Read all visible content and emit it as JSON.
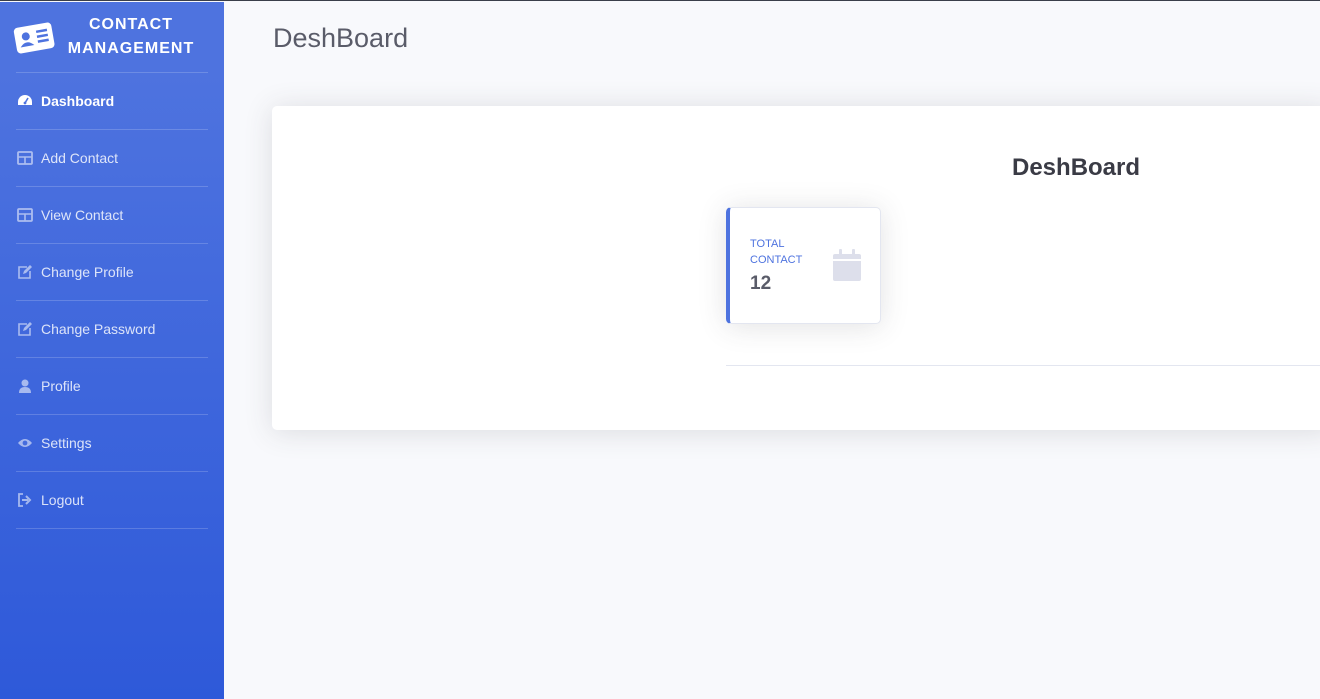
{
  "brand": {
    "line1": "CONTACT",
    "line2": "MANAGEMENT",
    "icon": "id-card-icon"
  },
  "sidebar": {
    "items": [
      {
        "label": "Dashboard",
        "icon": "tachometer-icon",
        "active": true
      },
      {
        "label": "Add Contact",
        "icon": "table-icon"
      },
      {
        "label": "View Contact",
        "icon": "table-icon"
      },
      {
        "label": "Change Profile",
        "icon": "edit-icon"
      },
      {
        "label": "Change Password",
        "icon": "edit-icon"
      },
      {
        "label": "Profile",
        "icon": "user-icon"
      },
      {
        "label": "Settings",
        "icon": "eye-icon"
      },
      {
        "label": "Logout",
        "icon": "sign-out-icon"
      }
    ]
  },
  "page": {
    "title": "DeshBoard"
  },
  "card": {
    "title": "DeshBoard",
    "stat": {
      "label": "TOTAL CONTACT",
      "value": "12",
      "icon": "calendar-icon"
    }
  },
  "colors": {
    "primary": "#4e73df",
    "sidebar_end": "#2e59d9",
    "background": "#f8f9fc",
    "text": "#5a5c69"
  }
}
